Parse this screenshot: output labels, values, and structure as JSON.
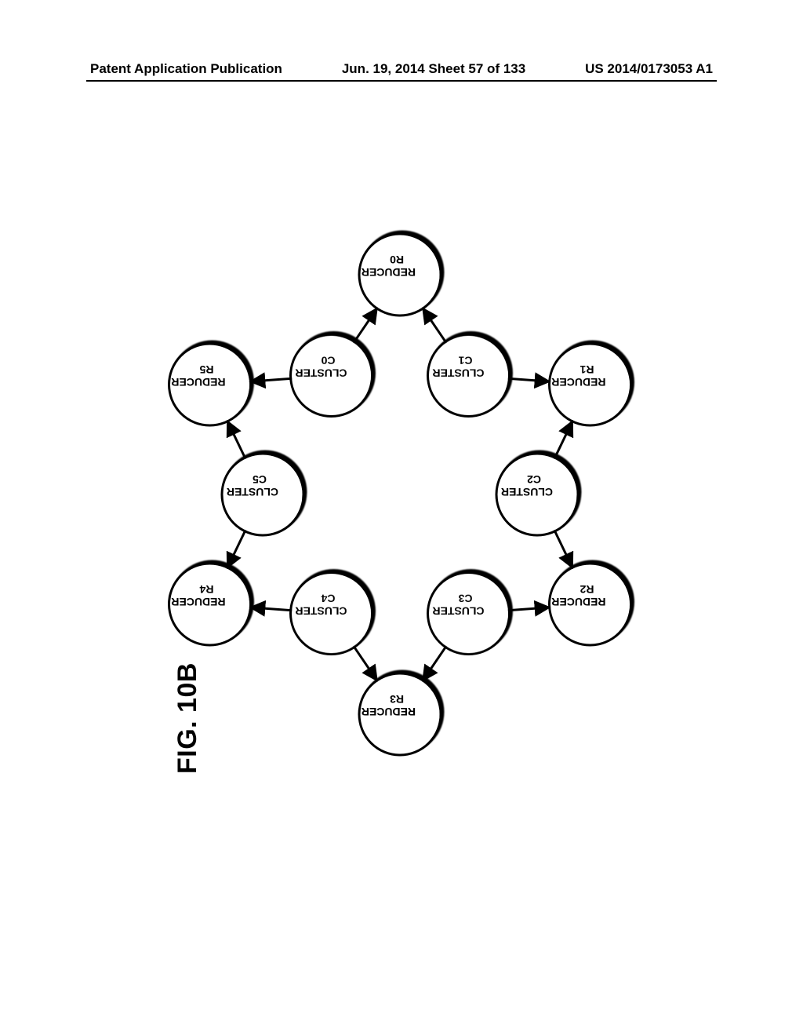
{
  "header": {
    "left": "Patent Application Publication",
    "center": "Jun. 19, 2014  Sheet 57 of 133",
    "right": "US 2014/0173053 A1"
  },
  "figure": {
    "caption": "FIG. 10B",
    "nodes": {
      "r0": {
        "line1": "REDUCER",
        "line2": "R0"
      },
      "r1": {
        "line1": "REDUCER",
        "line2": "R1"
      },
      "r2": {
        "line1": "REDUCER",
        "line2": "R2"
      },
      "r3": {
        "line1": "REDUCER",
        "line2": "R3"
      },
      "r4": {
        "line1": "REDUCER",
        "line2": "R4"
      },
      "r5": {
        "line1": "REDUCER",
        "line2": "R5"
      },
      "c0": {
        "line1": "CLUSTER",
        "line2": "C0"
      },
      "c1": {
        "line1": "CLUSTER",
        "line2": "C1"
      },
      "c2": {
        "line1": "CLUSTER",
        "line2": "C2"
      },
      "c3": {
        "line1": "CLUSTER",
        "line2": "C3"
      },
      "c4": {
        "line1": "CLUSTER",
        "line2": "C4"
      },
      "c5": {
        "line1": "CLUSTER",
        "line2": "C5"
      }
    }
  }
}
